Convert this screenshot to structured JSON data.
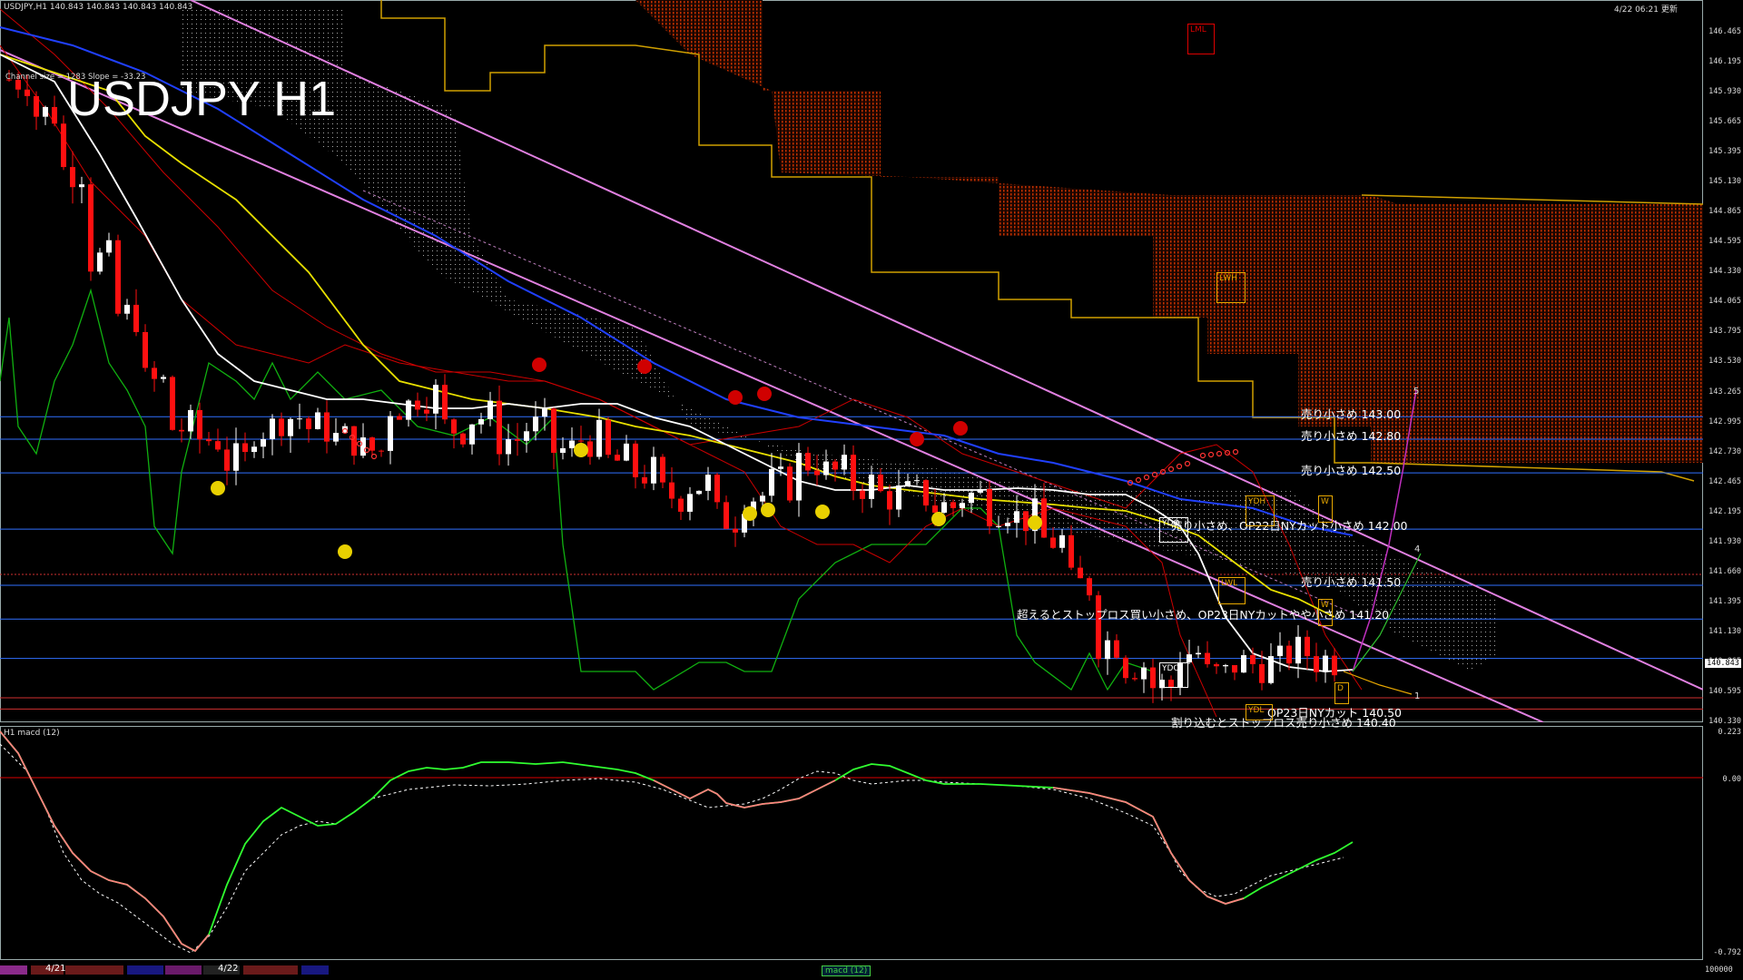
{
  "header": {
    "symbol_info": "USDJPY,H1  140.843 140.843 140.843 140.843",
    "timestamp": "4/22 06:21 更新",
    "channel_info": "Channel size = 1283 Slope = -33.23",
    "subwindow_title": "H1  macd (12)"
  },
  "title": "USDJPY H1",
  "price_axis": [
    "146.465",
    "146.195",
    "145.930",
    "145.665",
    "145.395",
    "145.130",
    "144.865",
    "144.595",
    "144.330",
    "144.065",
    "143.795",
    "143.530",
    "143.265",
    "142.995",
    "142.730",
    "142.465",
    "142.195",
    "141.930",
    "141.660",
    "141.395",
    "141.130",
    "140.865",
    "140.595",
    "140.330"
  ],
  "current_price": "140.843",
  "macd_axis": {
    "top": "0.223",
    "zero": "0.00",
    "bottom": "-0.792",
    "scale": "100000"
  },
  "levels": [
    {
      "id": "l143",
      "text": "売り小さめ 143.00"
    },
    {
      "id": "l1428",
      "text": "売り小さめ 142.80"
    },
    {
      "id": "l1425",
      "text": "売り小さめ 142.50"
    },
    {
      "id": "l142",
      "text": "売り小さめ、OP22日NYカット小さめ 142.00"
    },
    {
      "id": "l1415",
      "text": "売り小さめ 141.50"
    },
    {
      "id": "l1412",
      "text": "超えるとストップロス買い小さめ、OP23日NYカットやや小さめ 141.20"
    },
    {
      "id": "l1405",
      "text": "OP23日NYカット 140.50"
    },
    {
      "id": "l1404",
      "text": "割り込むとストップロス売り小さめ 140.40"
    }
  ],
  "boxes": [
    {
      "id": "lml",
      "text": "LML"
    },
    {
      "id": "lwh",
      "text": "LWH"
    },
    {
      "id": "ydh",
      "text": "YDH"
    },
    {
      "id": "ydo",
      "text": "YDO"
    },
    {
      "id": "lwl",
      "text": "LWL"
    },
    {
      "id": "ydc",
      "text": "YDC"
    },
    {
      "id": "ydl",
      "text": "YDL"
    },
    {
      "id": "w1",
      "text": "W"
    },
    {
      "id": "w2",
      "text": "W"
    },
    {
      "id": "d",
      "text": "D"
    }
  ],
  "wave_labels": [
    "5",
    "4",
    "1"
  ],
  "dates": [
    "4/21",
    "4/22"
  ],
  "tab_label": "macd (12)",
  "colors": {
    "background": "#000000",
    "cloud": "#c03000",
    "cloud_edge": "#d0a000",
    "bull_candle": "#ffffff",
    "bear_candle": "#ff1010",
    "ma_white": "#ffffff",
    "ma_yellow": "#e8e000",
    "ma_blue": "#2040ff",
    "channel": "#e080e0",
    "lagging": "#10b010",
    "hline": "#3070ff",
    "macd_up": "#30ff30",
    "macd_down": "#ff8080"
  },
  "chart_data": {
    "type": "candlestick",
    "symbol": "USDJPY",
    "timeframe": "H1",
    "ylim": [
      140.33,
      146.465
    ],
    "close_trend": [
      146.0,
      145.7,
      145.2,
      144.4,
      143.9,
      143.3,
      142.9,
      142.8,
      142.6,
      142.9,
      143.0,
      142.9,
      142.8,
      142.7,
      143.1,
      143.2,
      142.9,
      143.0,
      142.8,
      142.9,
      142.7,
      142.8,
      142.6,
      142.5,
      142.3,
      142.4,
      142.1,
      142.3,
      142.4,
      142.6,
      142.5,
      142.4,
      142.3,
      142.3,
      142.2,
      142.3,
      142.2,
      142.1,
      141.9,
      141.5,
      141.0,
      140.8,
      140.6,
      140.9,
      140.7,
      140.8,
      140.8,
      140.9,
      140.843
    ],
    "macd_ylim": [
      -0.792,
      0.223
    ]
  }
}
